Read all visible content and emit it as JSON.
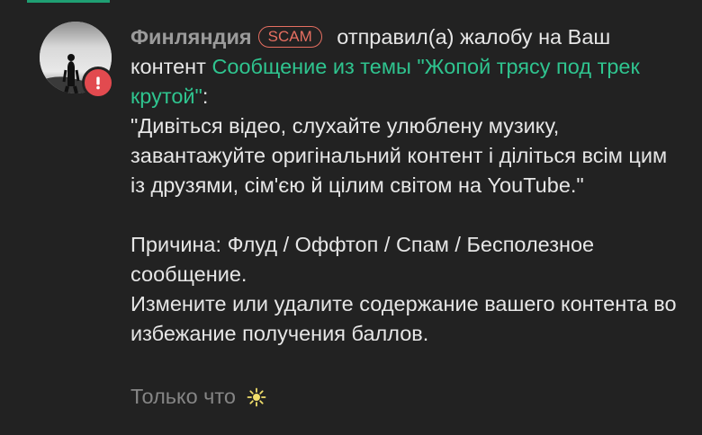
{
  "notification": {
    "username": "Финляндия",
    "badge": "SCAM",
    "action_text": " отправил(а) жалобу на Ваш контент ",
    "link_text": "Сообщение из темы \"Жопой трясу под трек крутой\"",
    "after_link": ":",
    "quote": "\"Дивіться відео, слухайте улюблену музику, завантажуйте оригінальний контент і діліться всім цим із друзями, сім'єю й цілим світом на YouTube.\"",
    "reason": "Причина: Флуд / Оффтоп / Спам / Бесполезное сообщение.",
    "advice": "Измените или удалите содержание вашего контента во избежание получения баллов.",
    "timestamp": "Только что"
  },
  "icons": {
    "alert": "exclamation-icon",
    "new": "sparkle-icon"
  },
  "colors": {
    "background": "#222222",
    "link": "#2fc48f",
    "username": "#9b9b9b",
    "scam_badge": "#e66f61",
    "alert_badge": "#e24a4f",
    "top_accent": "#1f9f73"
  }
}
